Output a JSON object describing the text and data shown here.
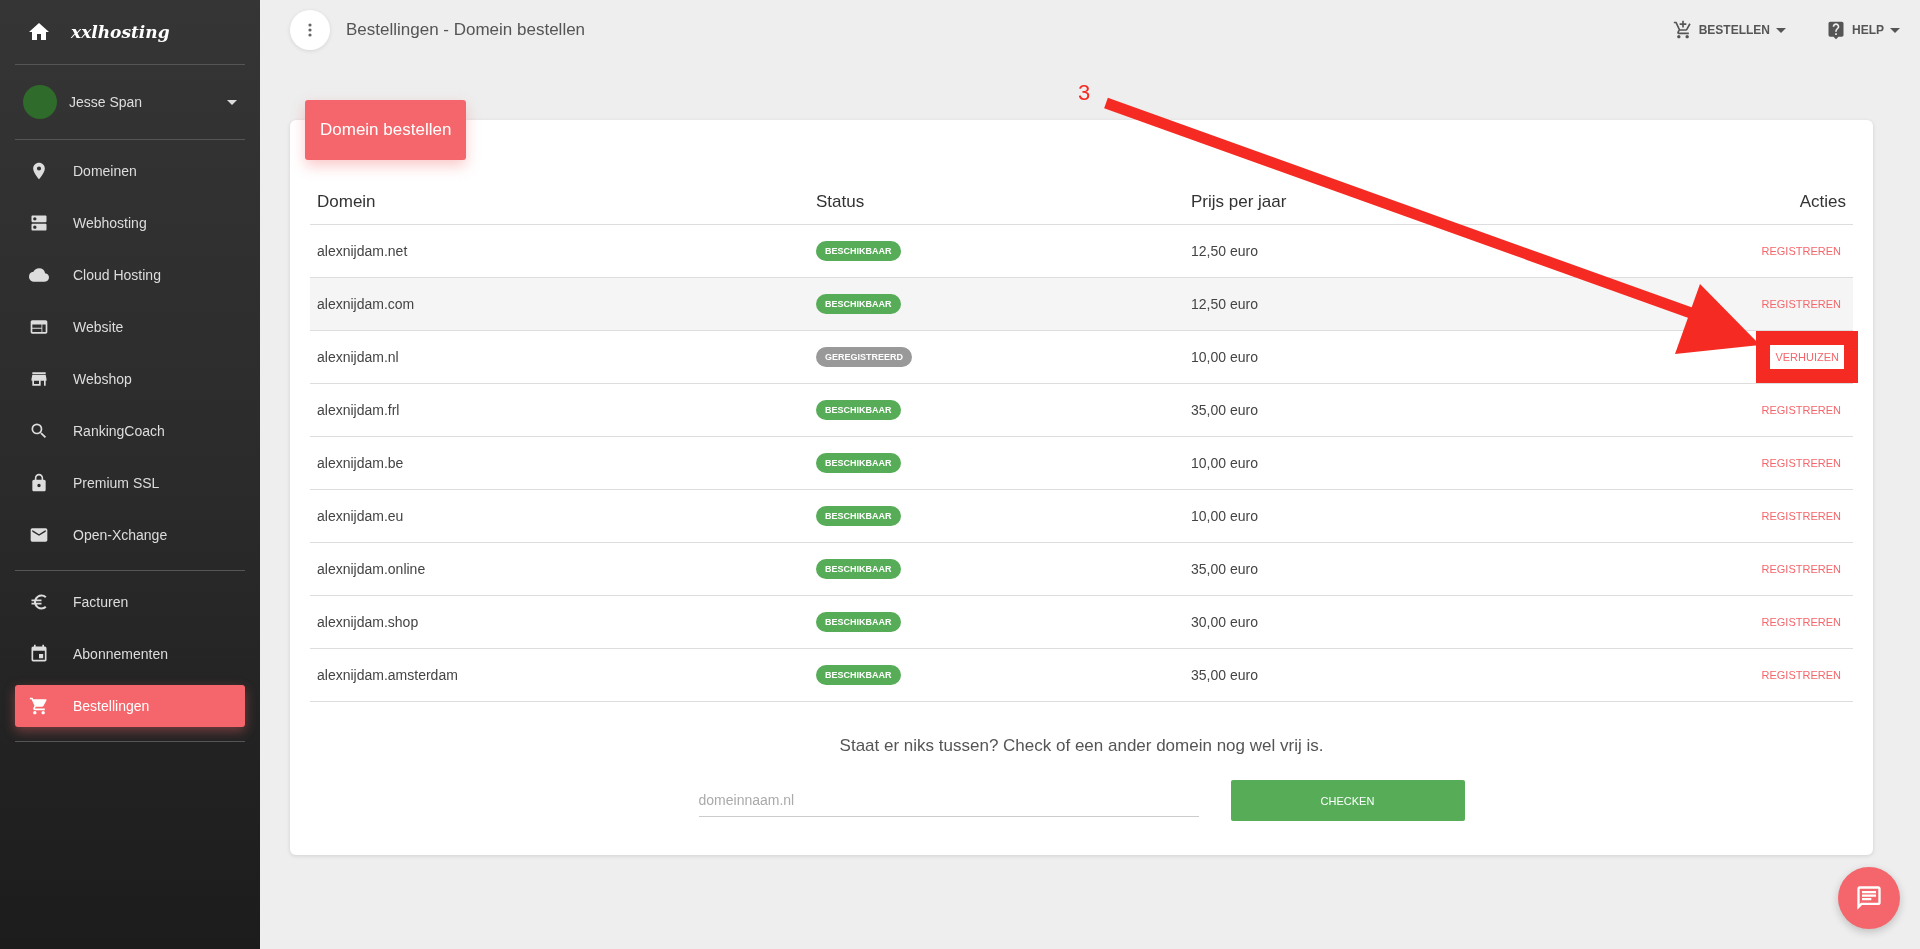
{
  "sidebar": {
    "brand": "xxlhosting",
    "user": "Jesse Span",
    "sections": [
      [
        {
          "label": "Domeinen",
          "selected": false
        },
        {
          "label": "Webhosting",
          "selected": false
        },
        {
          "label": "Cloud Hosting",
          "selected": false
        },
        {
          "label": "Website",
          "selected": false
        },
        {
          "label": "Webshop",
          "selected": false
        },
        {
          "label": "RankingCoach",
          "selected": false
        },
        {
          "label": "Premium SSL",
          "selected": false
        },
        {
          "label": "Open-Xchange",
          "selected": false
        }
      ],
      [
        {
          "label": "Facturen",
          "selected": false
        },
        {
          "label": "Abonnementen",
          "selected": false
        },
        {
          "label": "Bestellingen",
          "selected": true
        }
      ]
    ]
  },
  "topbar": {
    "title": "Bestellingen - Domein bestellen",
    "menus": [
      "BESTELLEN",
      "HELP"
    ]
  },
  "card": {
    "title": "Domein bestellen",
    "table": {
      "columns": [
        "Domein",
        "Status",
        "Prijs per jaar",
        "Acties"
      ],
      "rows": [
        {
          "domain": "alexnijdam.net",
          "status": {
            "label": "BESCHIKBAAR",
            "kind": "available"
          },
          "price": "12,50 euro",
          "action": "REGISTREREN",
          "hovered": false,
          "highlighted": false
        },
        {
          "domain": "alexnijdam.com",
          "status": {
            "label": "BESCHIKBAAR",
            "kind": "available"
          },
          "price": "12,50 euro",
          "action": "REGISTREREN",
          "hovered": true,
          "highlighted": false
        },
        {
          "domain": "alexnijdam.nl",
          "status": {
            "label": "GEREGISTREERD",
            "kind": "registered"
          },
          "price": "10,00 euro",
          "action": "VERHUIZEN",
          "hovered": false,
          "highlighted": true
        },
        {
          "domain": "alexnijdam.frl",
          "status": {
            "label": "BESCHIKBAAR",
            "kind": "available"
          },
          "price": "35,00 euro",
          "action": "REGISTREREN",
          "hovered": false,
          "highlighted": false
        },
        {
          "domain": "alexnijdam.be",
          "status": {
            "label": "BESCHIKBAAR",
            "kind": "available"
          },
          "price": "10,00 euro",
          "action": "REGISTREREN",
          "hovered": false,
          "highlighted": false
        },
        {
          "domain": "alexnijdam.eu",
          "status": {
            "label": "BESCHIKBAAR",
            "kind": "available"
          },
          "price": "10,00 euro",
          "action": "REGISTREREN",
          "hovered": false,
          "highlighted": false
        },
        {
          "domain": "alexnijdam.online",
          "status": {
            "label": "BESCHIKBAAR",
            "kind": "available"
          },
          "price": "35,00 euro",
          "action": "REGISTREREN",
          "hovered": false,
          "highlighted": false
        },
        {
          "domain": "alexnijdam.shop",
          "status": {
            "label": "BESCHIKBAAR",
            "kind": "available"
          },
          "price": "30,00 euro",
          "action": "REGISTREREN",
          "hovered": false,
          "highlighted": false
        },
        {
          "domain": "alexnijdam.amsterdam",
          "status": {
            "label": "BESCHIKBAAR",
            "kind": "available"
          },
          "price": "35,00 euro",
          "action": "REGISTREREN",
          "hovered": false,
          "highlighted": false
        }
      ]
    },
    "check_prompt": "Staat er niks tussen? Check of een ander domein nog wel vrij is.",
    "search": {
      "placeholder": "domeinnaam.nl"
    },
    "check_button": "CHECKEN"
  },
  "annotation": {
    "label": "3"
  }
}
